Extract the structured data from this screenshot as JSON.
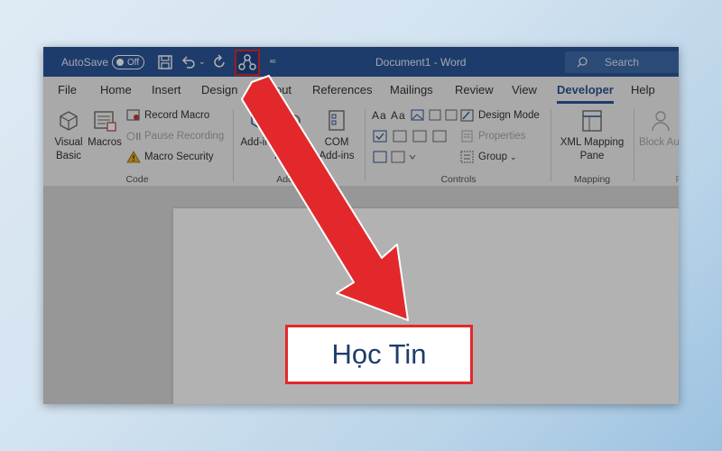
{
  "titlebar": {
    "autosave_label": "AutoSave",
    "autosave_state": "Off",
    "document_title": "Document1  -  Word",
    "search_placeholder": "Search",
    "bg_color": "#2b579a"
  },
  "menu": {
    "tabs": [
      "File",
      "Home",
      "Insert",
      "Design",
      "Layout",
      "References",
      "Mailings",
      "Review",
      "View",
      "Developer",
      "Help"
    ],
    "active_tab": "Developer"
  },
  "ribbon": {
    "code": {
      "label": "Code",
      "visual_basic": "Visual Basic",
      "macros": "Macros",
      "record_macro": "Record Macro",
      "pause_recording": "Pause Recording",
      "macro_security": "Macro Security"
    },
    "addins": {
      "label": "Add-ins",
      "addins_btn": "Add-ins",
      "word_addins": "Word Add-ins",
      "com_addins": "COM Add-ins"
    },
    "controls": {
      "label": "Controls",
      "design_mode": "Design Mode",
      "properties": "Properties",
      "group": "Group"
    },
    "mapping": {
      "label": "Mapping",
      "xml_mapping_pane": "XML Mapping Pane"
    },
    "protect": {
      "block_authors": "Block Authors"
    }
  },
  "overlay": {
    "label": "Học Tin",
    "accent_color": "#e3282c"
  }
}
